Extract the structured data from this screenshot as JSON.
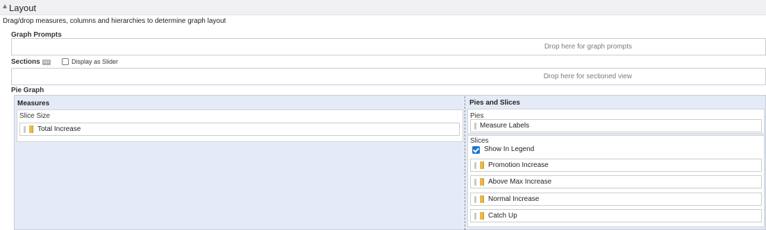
{
  "layout": {
    "title": "Layout",
    "instructions": "Drag/drop measures, columns and hierarchies to determine graph layout"
  },
  "graph_prompts": {
    "label": "Graph Prompts",
    "drop_text": "Drop here for graph prompts"
  },
  "sections": {
    "label": "Sections",
    "icon_text": "xyz",
    "slider_label": "Display as Slider",
    "slider_checked": false,
    "drop_text": "Drop here for sectioned view"
  },
  "pie_graph": {
    "label": "Pie Graph",
    "measures": {
      "title": "Measures",
      "slice_size_label": "Slice Size",
      "items": [
        "Total Increase"
      ]
    },
    "pies_and_slices": {
      "title": "Pies and Slices",
      "pies_label": "Pies",
      "pies_items": [
        "Measure Labels"
      ],
      "slices_label": "Slices",
      "show_in_legend_label": "Show In Legend",
      "show_in_legend_checked": true,
      "slices_items": [
        "Promotion Increase",
        "Above Max Increase",
        "Normal Increase",
        "Catch Up"
      ]
    }
  },
  "colors": {
    "accent": "#1f74d1",
    "measure_icon": "#e8b84b",
    "panel_bg": "#e4ebf6"
  }
}
